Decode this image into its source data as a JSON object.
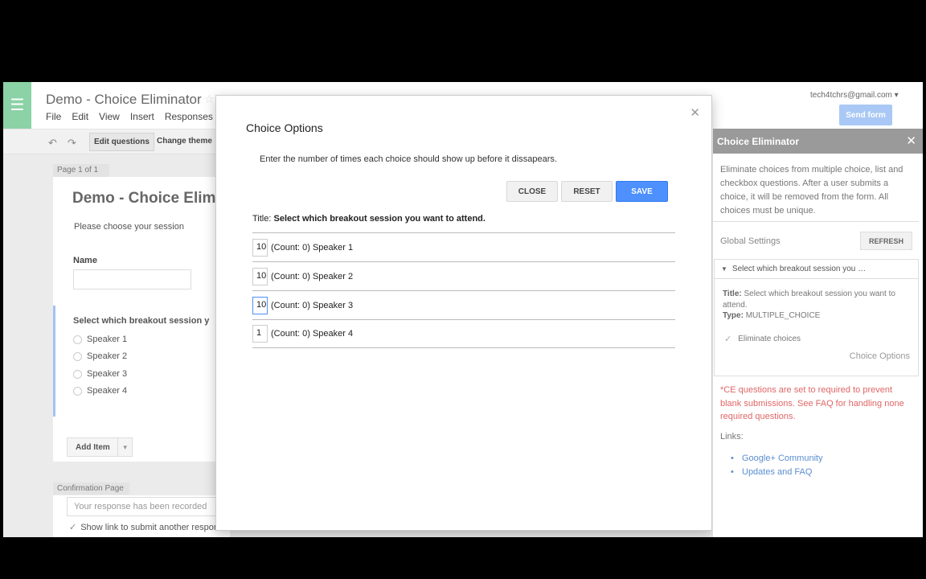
{
  "header": {
    "doc_title": "Demo - Choice Eliminator",
    "menus": [
      "File",
      "Edit",
      "View",
      "Insert",
      "Responses"
    ],
    "account": "tech4tchrs@gmail.com",
    "send_label": "Send form"
  },
  "toolbar": {
    "edit_label": "Edit questions",
    "theme_label": "Change theme"
  },
  "form": {
    "page_label": "Page 1 of 1",
    "title": "Demo - Choice Elimi",
    "description": "Please choose your session",
    "name_label": "Name",
    "question_title": "Select which breakout session y",
    "options": [
      "Speaker 1",
      "Speaker 2",
      "Speaker 3",
      "Speaker 4"
    ],
    "add_item_label": "Add Item",
    "confirmation_label": "Confirmation Page",
    "confirmation_value": "Your response has been recorded",
    "show_link_label": "Show link to submit another response"
  },
  "modal": {
    "title": "Choice Options",
    "instructions": "Enter the number of times each choice should show up before it dissapears.",
    "close_label": "CLOSE",
    "reset_label": "RESET",
    "save_label": "SAVE",
    "question_prefix": "Title:",
    "question_title": "Select which breakout session you want to attend.",
    "choices": [
      {
        "value": "10",
        "label": "(Count: 0) Speaker 1"
      },
      {
        "value": "10",
        "label": "(Count: 0) Speaker 2"
      },
      {
        "value": "10",
        "label": "(Count: 0) Speaker 3"
      },
      {
        "value": "1",
        "label": "(Count: 0) Speaker 4"
      }
    ]
  },
  "sidebar": {
    "title": "Choice Eliminator",
    "description": "Eliminate choices from multiple choice, list and checkbox questions. After a user submits a choice, it will be removed from the form. All choices must be unique.",
    "global_settings": "Global Settings",
    "refresh_label": "REFRESH",
    "panel_header": "Select which breakout session you …",
    "panel_title_label": "Title:",
    "panel_title": "Select which breakout session you want to attend.",
    "panel_type_label": "Type:",
    "panel_type": "MULTIPLE_CHOICE",
    "eliminate_label": "Eliminate choices",
    "choice_options_link": "Choice Options",
    "warning": "*CE questions are set to required to prevent blank submissions. See FAQ for handling none required questions.",
    "links_label": "Links:",
    "links": [
      "Google+ Community",
      "Updates and FAQ"
    ]
  },
  "colors": {
    "accent_blue": "#4d90fe",
    "app_green": "#8bd2a6",
    "warning_red": "#e06666",
    "link_blue": "#5b8ed0"
  }
}
